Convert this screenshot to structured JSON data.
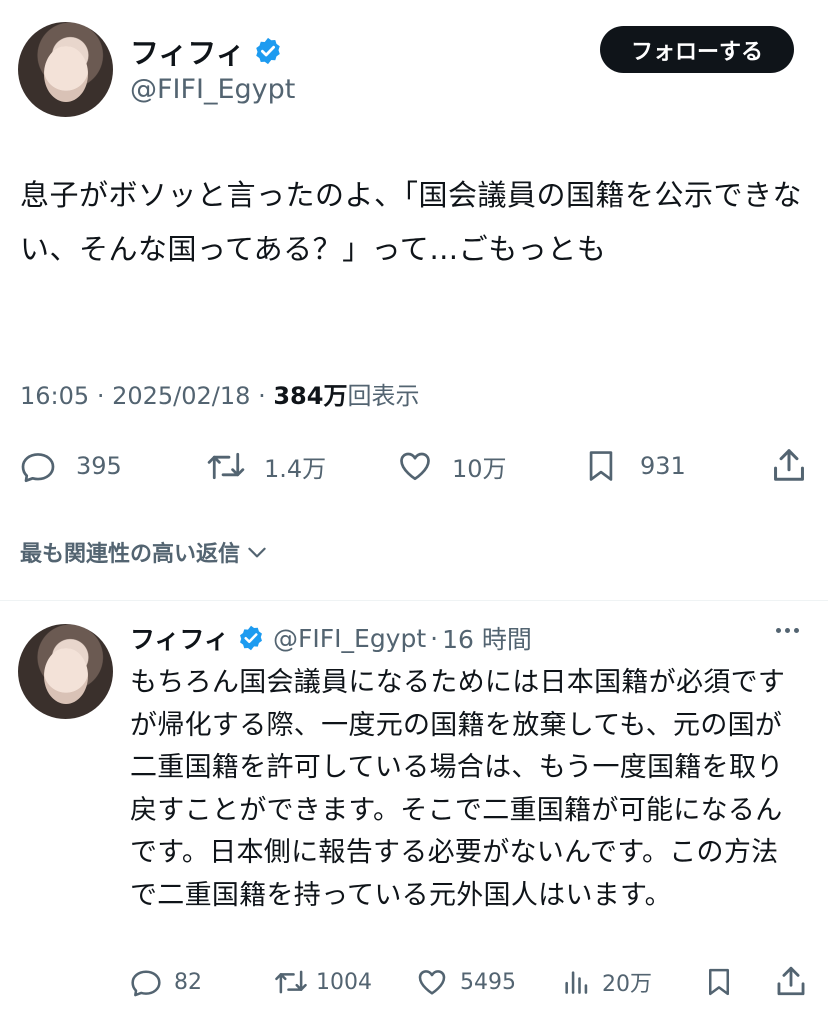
{
  "main_tweet": {
    "author_name": "フィフィ",
    "handle": "@FIFI_Egypt",
    "follow_label": "フォローする",
    "text": "息子がボソッと言ったのよ、「国会議員の国籍を公示できない、そんな国ってある？」って…ごもっとも",
    "time": "16:05",
    "date": "2025/02/18",
    "separator": "·",
    "views_count": "384万",
    "views_label": "回表示",
    "stats": {
      "replies": "395",
      "retweets": "1.4万",
      "likes": "10万",
      "bookmarks": "931"
    }
  },
  "related_replies_label": "最も関連性の高い返信",
  "reply": {
    "author_name": "フィフィ",
    "handle": "@FIFI_Egypt",
    "separator": "·",
    "time_ago": "16 時間",
    "text": "もちろん国会議員になるためには日本国籍が必須ですが帰化する際、一度元の国籍を放棄しても、元の国が二重国籍を許可している場合は、もう一度国籍を取り戻すことができます。そこで二重国籍が可能になるんです。日本側に報告する必要がないんです。この方法で二重国籍を持っている元外国人はいます。",
    "stats": {
      "replies": "82",
      "retweets": "1004",
      "likes": "5495",
      "views": "20万"
    }
  },
  "colors": {
    "text": "#0f1419",
    "secondary": "#536471",
    "verified": "#1d9bf0",
    "button_bg": "#0f1419",
    "divider": "#eff3f4"
  },
  "icons": {
    "reply": "speech-bubble-icon",
    "retweet": "retweet-icon",
    "like": "heart-icon",
    "bookmark": "bookmark-icon",
    "share": "share-icon",
    "views": "bar-chart-icon",
    "more": "more-dots-icon",
    "verified": "verified-badge-icon",
    "chevron": "chevron-down-icon"
  }
}
